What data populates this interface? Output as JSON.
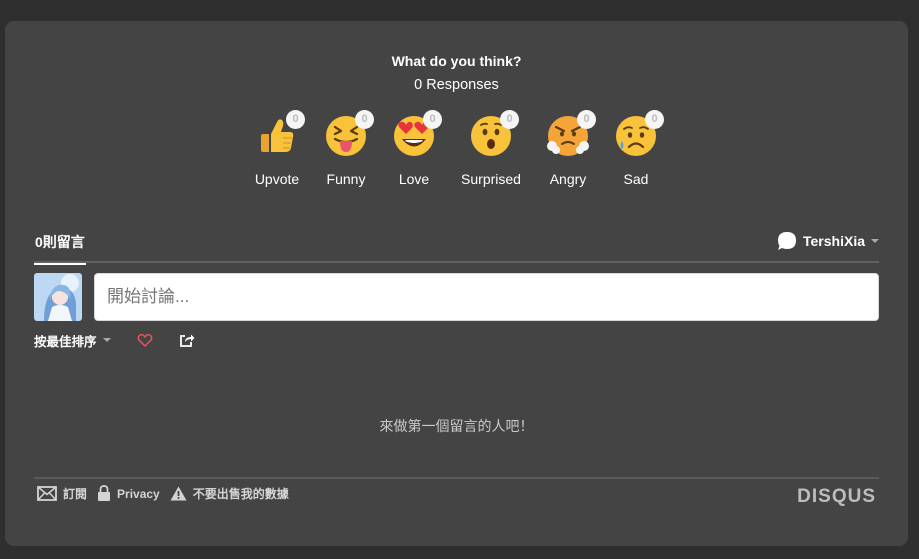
{
  "reactions": {
    "title": "What do you think?",
    "responses": "0 Responses",
    "items": [
      {
        "label": "Upvote",
        "count": "0",
        "icon": "thumbs-up-icon"
      },
      {
        "label": "Funny",
        "count": "0",
        "icon": "tongue-face-icon"
      },
      {
        "label": "Love",
        "count": "0",
        "icon": "heart-eyes-icon"
      },
      {
        "label": "Surprised",
        "count": "0",
        "icon": "surprised-face-icon"
      },
      {
        "label": "Angry",
        "count": "0",
        "icon": "angry-face-icon"
      },
      {
        "label": "Sad",
        "count": "0",
        "icon": "sad-face-icon"
      }
    ]
  },
  "tabs": {
    "comments": "0則留言",
    "username": "TershiXia"
  },
  "composer": {
    "placeholder": "開始討論..."
  },
  "toolbar": {
    "sort_label": "按最佳排序"
  },
  "empty_message": "來做第一個留言的人吧！",
  "footer": {
    "subscribe": "訂閱",
    "privacy": "Privacy",
    "do_not_sell": "不要出售我的數據",
    "brand": "DISQUS"
  },
  "colors": {
    "background": "#2f2f2f",
    "card": "#444444",
    "emoji_yellow": "#f8c23a",
    "heart": "#e8545a"
  }
}
